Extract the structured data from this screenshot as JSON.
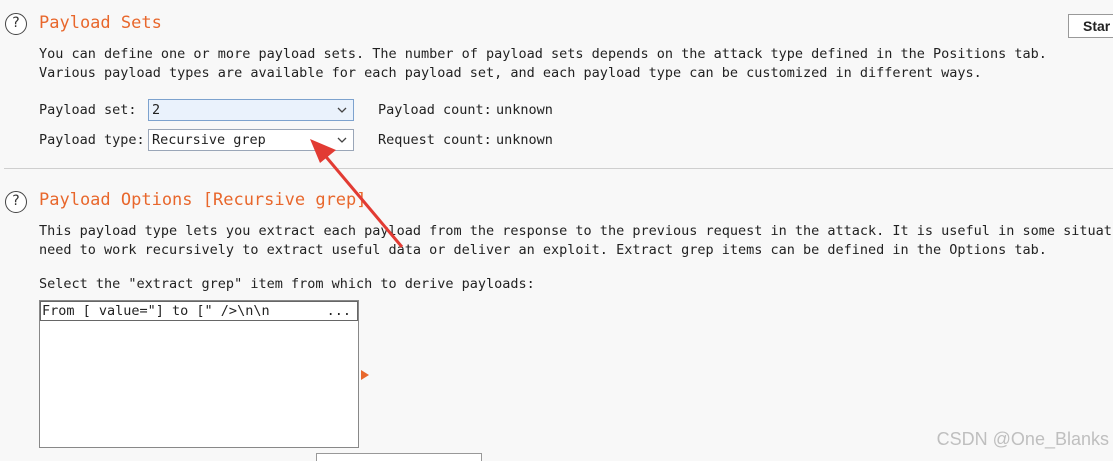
{
  "payload_sets": {
    "title": "Payload Sets",
    "help": "?",
    "description_line1": "You can define one or more payload sets. The number of payload sets depends on the attack type defined in the Positions tab.",
    "description_line2": "Various payload types are available for each payload set, and each payload type can be customized in different ways.",
    "payload_set_label": "Payload set:",
    "payload_set_value": "2",
    "payload_type_label": "Payload type:",
    "payload_type_value": "Recursive grep",
    "payload_count_label": "Payload count:",
    "payload_count_value": "unknown",
    "request_count_label": "Request count:",
    "request_count_value": "unknown",
    "start_button": "Star"
  },
  "payload_options": {
    "title": "Payload Options [Recursive grep]",
    "help": "?",
    "description_line1": "This payload type lets you extract each payload from the response to the previous request in the attack. It is useful in some situatio",
    "description_line2": "need to work recursively to extract useful data or deliver an exploit. Extract grep items can be defined in the Options tab.",
    "select_label": "Select the \"extract grep\" item from which to derive payloads:",
    "grep_items": [
      {
        "text": "From [ value=\"] to [\" />\\n\\n",
        "more": "..."
      }
    ]
  },
  "watermark": "CSDN @One_Blanks",
  "colors": {
    "accent": "#e8672c",
    "arrow": "#e23b33"
  }
}
